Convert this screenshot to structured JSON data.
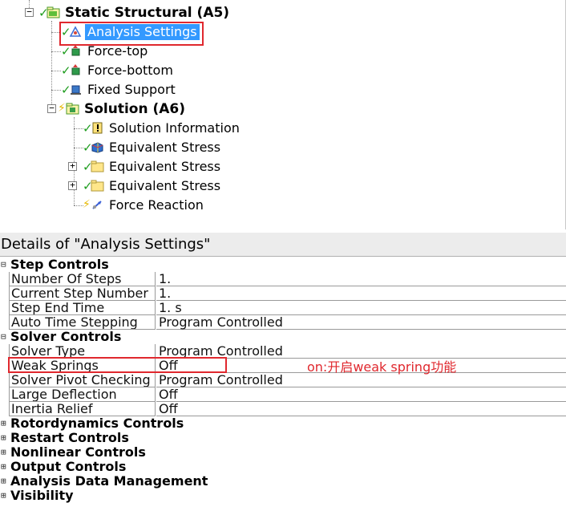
{
  "tree": {
    "nodes": [
      {
        "label": "Static Structural (A5)",
        "bold": true,
        "icon": "static-structural-icon",
        "check": true
      },
      {
        "label": "Analysis Settings",
        "bold": false,
        "icon": "analysis-settings-icon",
        "check": true,
        "selected": true
      },
      {
        "label": "Force-top",
        "bold": false,
        "icon": "force-icon",
        "check": true
      },
      {
        "label": "Force-bottom",
        "bold": false,
        "icon": "force-icon",
        "check": true
      },
      {
        "label": "Fixed Support",
        "bold": false,
        "icon": "fixed-support-icon",
        "check": true
      },
      {
        "label": "Solution (A6)",
        "bold": true,
        "icon": "solution-icon",
        "check": false
      },
      {
        "label": "Solution Information",
        "bold": false,
        "icon": "solution-information-icon",
        "check": true
      },
      {
        "label": "Equivalent Stress",
        "bold": false,
        "icon": "equivalent-stress-icon",
        "check": true
      },
      {
        "label": "Equivalent Stress",
        "bold": false,
        "icon": "folder-icon",
        "check": true
      },
      {
        "label": "Equivalent Stress",
        "bold": false,
        "icon": "folder-icon",
        "check": true
      },
      {
        "label": "Force Reaction",
        "bold": false,
        "icon": "force-reaction-icon",
        "check": false
      }
    ]
  },
  "details": {
    "title": "Details of \"Analysis Settings\"",
    "sections": {
      "step_controls": "Step Controls",
      "solver_controls": "Solver Controls",
      "rotordynamics": "Rotordynamics Controls",
      "restart": "Restart Controls",
      "nonlinear": "Nonlinear Controls",
      "output": "Output Controls",
      "analysis_data": "Analysis Data Management",
      "visibility": "Visibility"
    },
    "step_props": [
      {
        "name": "Number Of Steps",
        "value": "1."
      },
      {
        "name": "Current Step Number",
        "value": "1."
      },
      {
        "name": "Step End Time",
        "value": "1. s"
      },
      {
        "name": "Auto Time Stepping",
        "value": "Program Controlled"
      }
    ],
    "solver_props": [
      {
        "name": "Solver Type",
        "value": "Program Controlled"
      },
      {
        "name": "Weak Springs",
        "value": "Off"
      },
      {
        "name": "Solver Pivot Checking",
        "value": "Program Controlled"
      },
      {
        "name": "Large Deflection",
        "value": "Off"
      },
      {
        "name": "Inertia Relief",
        "value": "Off"
      }
    ],
    "expanded_symbol": "⊟",
    "collapsed_symbol": "⊞"
  },
  "annotation": {
    "text": "on:开启weak spring功能",
    "color": "#e0282e"
  }
}
